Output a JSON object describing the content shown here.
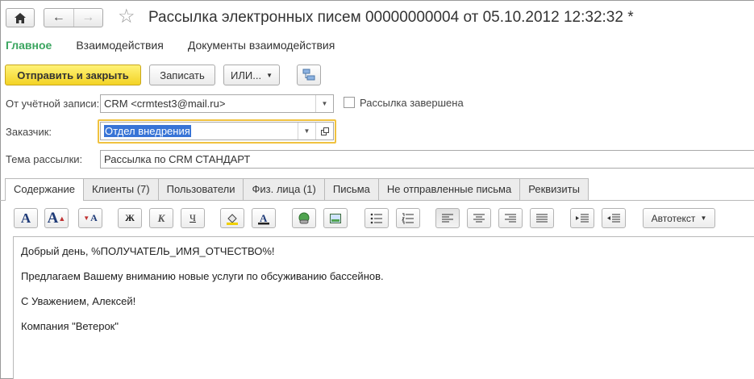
{
  "window": {
    "title": "Рассылка электронных писем 00000000004 от 05.10.2012 12:32:32 *"
  },
  "sections": [
    {
      "label": "Главное",
      "active": true
    },
    {
      "label": "Взаимодействия",
      "active": false
    },
    {
      "label": "Документы взаимодействия",
      "active": false
    }
  ],
  "commands": {
    "send_close": "Отправить и закрыть",
    "write": "Записать",
    "or": "ИЛИ..."
  },
  "form": {
    "account_label": "От учётной записи:",
    "account_value": "CRM <crmtest3@mail.ru>",
    "finished_label": "Рассылка завершена",
    "finished_checked": false,
    "customer_label": "Заказчик:",
    "customer_value": "Отдел внедрения",
    "subject_label": "Тема рассылки:",
    "subject_value": "Рассылка по CRM СТАНДАРТ"
  },
  "tabs": [
    {
      "label": "Содержание",
      "active": true
    },
    {
      "label": "Клиенты (7)",
      "active": false
    },
    {
      "label": "Пользователи",
      "active": false
    },
    {
      "label": "Физ. лица (1)",
      "active": false
    },
    {
      "label": "Письма",
      "active": false
    },
    {
      "label": "Не отправленные письма",
      "active": false
    },
    {
      "label": "Реквизиты",
      "active": false
    }
  ],
  "toolbar": {
    "bold_glyph": "Ж",
    "italic_glyph": "К",
    "underline_glyph": "Ч",
    "autotext_label": "Автотекст"
  },
  "editor": {
    "lines": [
      "Добрый день, %ПОЛУЧАТЕЛЬ_ИМЯ_ОТЧЕСТВО%!",
      "Предлагаем Вашему вниманию новые услуги по обсуживанию бассейнов.",
      "С Уважением, Алексей!",
      "Компания \"Ветерок\""
    ]
  },
  "colors": {
    "accent_green": "#3aa55f",
    "primary_yellow": "#f3d325",
    "focus_border": "#f0c240",
    "selection": "#3874d6"
  }
}
